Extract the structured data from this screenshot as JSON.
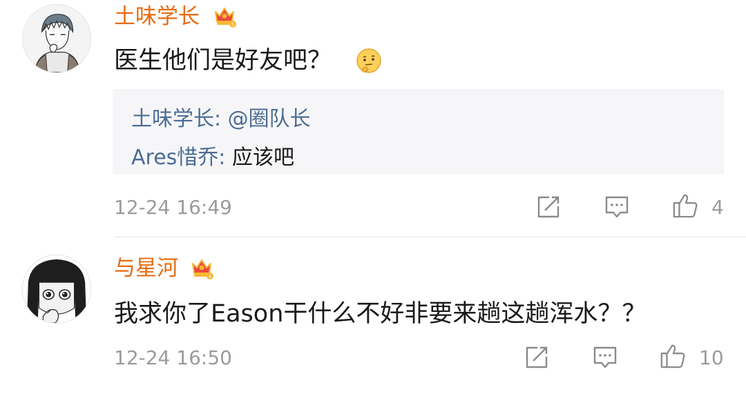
{
  "comments": [
    {
      "username": "土味学长",
      "text": "医生他们是好友吧？",
      "emoji": "thinking-face-emoji",
      "replies": [
        {
          "user": "土味学长",
          "separator": ": ",
          "content": "@圈队长"
        },
        {
          "user": "Ares惜乔",
          "separator": ": ",
          "content": "应该吧"
        }
      ],
      "timestamp": "12-24 16:49",
      "likes": "4",
      "badge": "crown-badge-icon",
      "badge_level": "5"
    },
    {
      "username": "与星河",
      "text": "我求你了Eason干什么不好非要来趟这趟浑水？？",
      "timestamp": "12-24 16:50",
      "likes": "10",
      "badge": "crown-badge-icon",
      "badge_level": "4"
    }
  ],
  "colors": {
    "username": "#e86b0f",
    "reply_user": "#4c6c93",
    "meta_text": "#9b9b9b",
    "reply_bg": "#f6f6f8",
    "crown_red": "#e84a3c",
    "crown_gold": "#f7b733"
  },
  "icons": {
    "repost": "share-edit-icon",
    "comment": "comment-bubble-icon",
    "like": "thumbs-up-icon"
  }
}
